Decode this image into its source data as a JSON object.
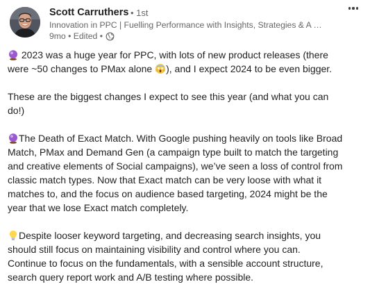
{
  "post": {
    "author": {
      "name": "Scott Carruthers",
      "connection_degree": "• 1st",
      "headline": "Innovation in PPC | Fuelling Performance with Insights, Strategies & A …",
      "meta": "9mo • Edited •",
      "meta_icon": "globe-icon"
    },
    "menu_icon": "more-options-icon",
    "body": {
      "p1_line1": "2023 was a huge year for PPC, with lots of new product releases (there",
      "p1_line2a": "were ~50 changes to PMax alone",
      "p1_line2b": "), and I expect 2024 to be even bigger.",
      "p2_line1": "These are the biggest changes I expect to see this year (and what you can",
      "p2_line2": "do!)",
      "p3_line1": "The Death of Exact Match. With Google pushing heavily on tools like Broad",
      "p3_line2": "Match, PMax and Demand Gen (a campaign type built to match the targeting",
      "p3_line3": "and creative elements of Social campaigns), we’ve seen a loss of control from",
      "p3_line4": "classic match types. Now that Exact match can be very loose with what it",
      "p3_line5": "matches to, and the focus on audience based targeting, 2024 might be the",
      "p3_line6": "year that we lose Exact match completely.",
      "p4_line1": "Despite looser keyword targeting, and decreasing search insights, you",
      "p4_line2": "should still focus on maintaining visibility and control where you can.",
      "p4_line3": "Continue to focus on the fundamentals, with a sensible account structure,",
      "p4_line4": "search query report work and A/B testing where possible."
    },
    "emojis": [
      "crystal-ball-icon",
      "screaming-face-icon",
      "crystal-ball-icon",
      "light-bulb-icon"
    ]
  }
}
